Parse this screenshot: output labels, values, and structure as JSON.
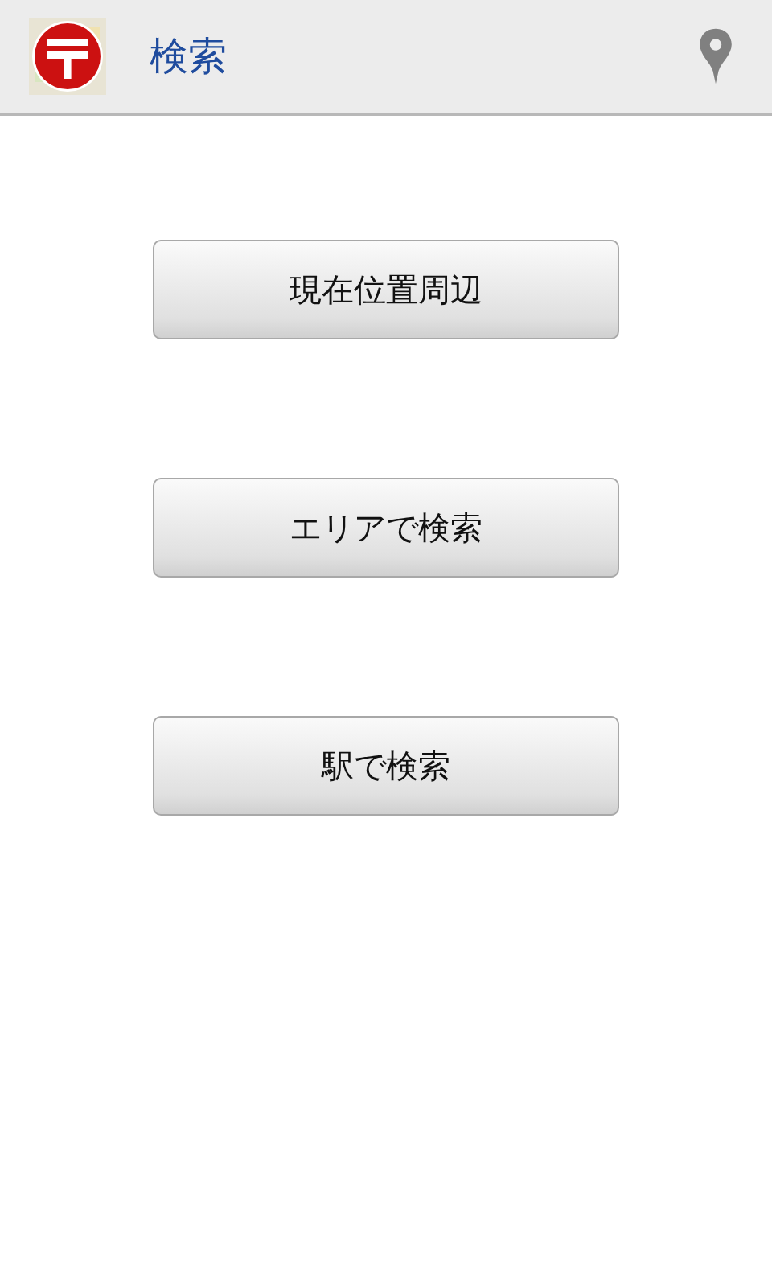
{
  "action_bar": {
    "title": "検索"
  },
  "buttons": [
    {
      "label": "現在位置周辺"
    },
    {
      "label": "エリアで検索"
    },
    {
      "label": "駅で検索"
    }
  ]
}
